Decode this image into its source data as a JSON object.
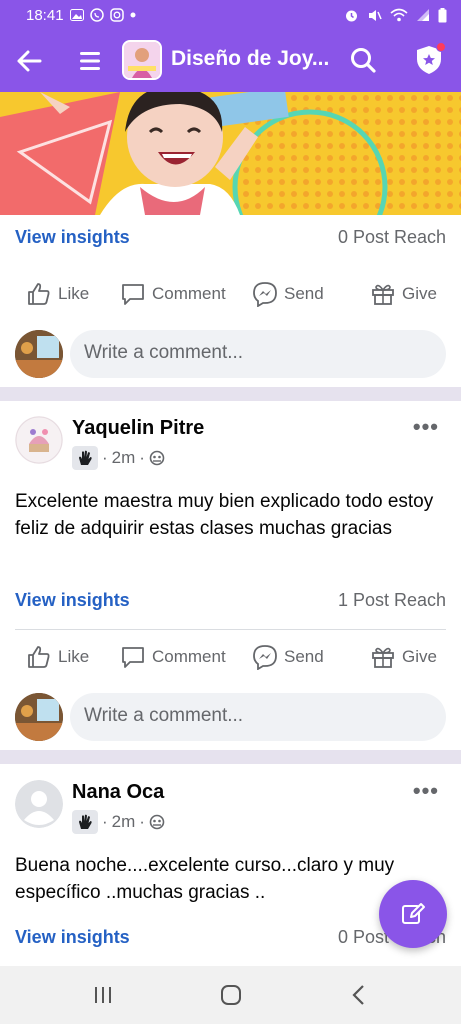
{
  "status_bar": {
    "time": "18:41"
  },
  "app_bar": {
    "title": "Diseño de Joy..."
  },
  "posts": [
    {
      "insights_label": "View insights",
      "reach": "0 Post Reach",
      "actions": {
        "like": "Like",
        "comment": "Comment",
        "send": "Send",
        "give": "Give"
      },
      "comment_placeholder": "Write a comment..."
    },
    {
      "author": "Yaquelin Pitre",
      "time": "2m",
      "text": "Excelente maestra muy bien explicado todo estoy feliz de adquirir estas clases muchas gracias",
      "insights_label": "View insights",
      "reach": "1 Post Reach",
      "actions": {
        "like": "Like",
        "comment": "Comment",
        "send": "Send",
        "give": "Give"
      },
      "comment_placeholder": "Write a comment..."
    },
    {
      "author": "Nana Oca",
      "time": "2m",
      "text": "Buena noche....excelente curso...claro y muy específico ..muchas gracias ..",
      "insights_label": "View insights",
      "reach": "0 Post Reach"
    }
  ],
  "colors": {
    "brand": "#8a55e8",
    "link": "#2561c4",
    "muted": "#65676b"
  }
}
